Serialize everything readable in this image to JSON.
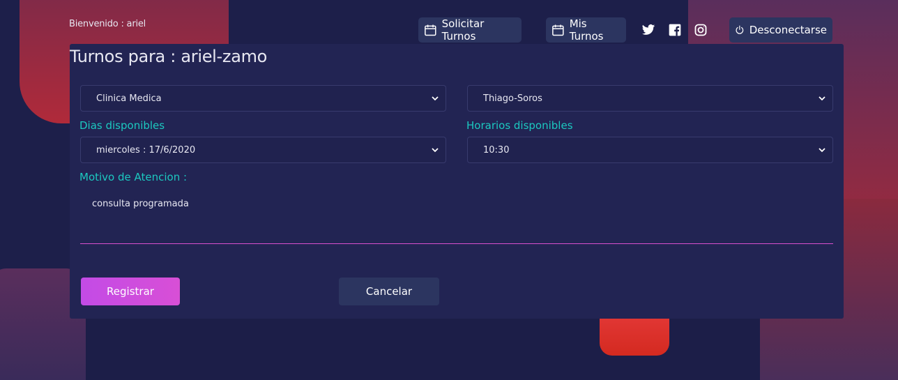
{
  "header": {
    "welcome": "Bienvenido : ariel",
    "nav": {
      "solicitar_label": "Solicitar Turnos",
      "mis_label": "Mis Turnos",
      "logout_label": "Desconectarse"
    },
    "social_icons": [
      "twitter-icon",
      "facebook-icon",
      "instagram-icon"
    ]
  },
  "form": {
    "title": "Turnos para : ariel-zamo",
    "especialidad": "Clinica Medica",
    "medico": "Thiago-Soros",
    "dias_label": "Dias disponibles",
    "dia": "miercoles : 17/6/2020",
    "horarios_label": "Horarios disponibles",
    "hora": "10:30",
    "motivo_label": "Motivo de Atencion :",
    "motivo": "consulta programada",
    "registrar_label": "Registrar",
    "cancelar_label": "Cancelar"
  },
  "colors": {
    "background": "#1d1f4a",
    "card": "#222453",
    "accent_label": "#1cc9c0",
    "primary_button": "#c34be6",
    "secondary_button": "#2c3560",
    "underline": "#d94fd0"
  }
}
